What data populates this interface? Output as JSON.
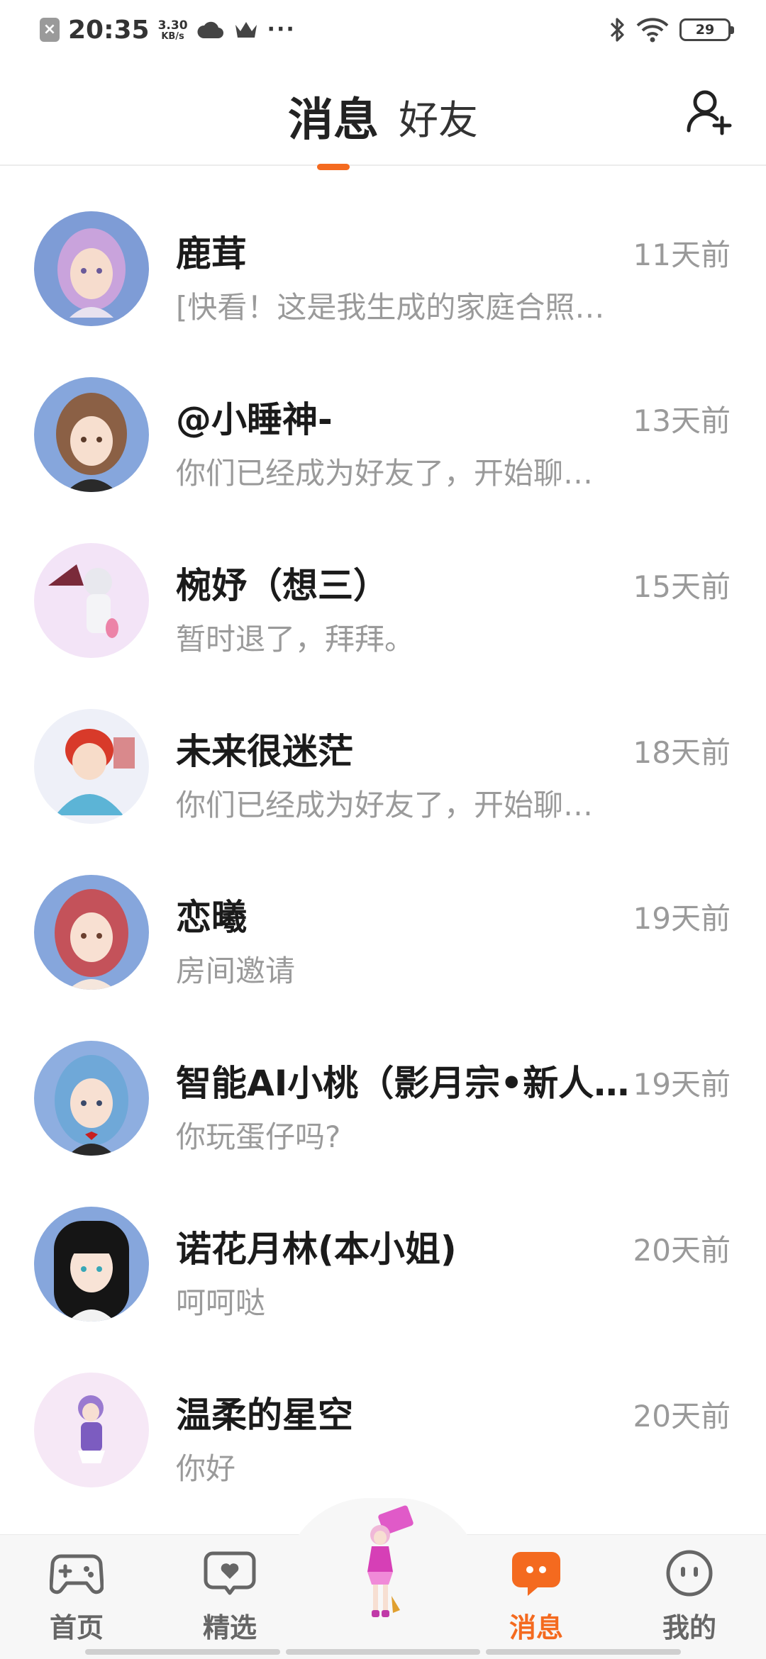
{
  "status_bar": {
    "time": "20:35",
    "speed_value": "3.30",
    "speed_unit": "KB/s",
    "battery": "29"
  },
  "header": {
    "tabs": [
      {
        "label": "消息",
        "active": true
      },
      {
        "label": "好友",
        "active": false
      }
    ],
    "add_friend_icon": "add-person-icon",
    "accent_color": "#f46a1f"
  },
  "messages": [
    {
      "name": "鹿茸",
      "time": "11天前",
      "preview": "[快看！这是我生成的家庭合照…"
    },
    {
      "name": "@小睡神-",
      "time": "13天前",
      "preview": "你们已经成为好友了，开始聊…"
    },
    {
      "name": "椀妤（想三）",
      "time": "15天前",
      "preview": "暂时退了，拜拜。"
    },
    {
      "name": "未来很迷茫",
      "time": "18天前",
      "preview": "你们已经成为好友了，开始聊…"
    },
    {
      "name": "恋曦",
      "time": "19天前",
      "preview": "房间邀请"
    },
    {
      "name": "智能AI小桃（影月宗•新人…",
      "time": "19天前",
      "preview": "你玩蛋仔吗?"
    },
    {
      "name": "诺花月林(本小姐)",
      "time": "20天前",
      "preview": "呵呵哒"
    },
    {
      "name": "温柔的星空",
      "time": "20天前",
      "preview": "你好"
    }
  ],
  "bottom_nav": {
    "items": [
      {
        "label": "首页",
        "icon": "gamepad-icon",
        "active": false
      },
      {
        "label": "精选",
        "icon": "heart-chat-icon",
        "active": false
      },
      {
        "label": "消息",
        "icon": "message-bubble-icon",
        "active": true
      },
      {
        "label": "我的",
        "icon": "smiley-face-icon",
        "active": false
      }
    ],
    "center_icon": "character-avatar-icon"
  }
}
